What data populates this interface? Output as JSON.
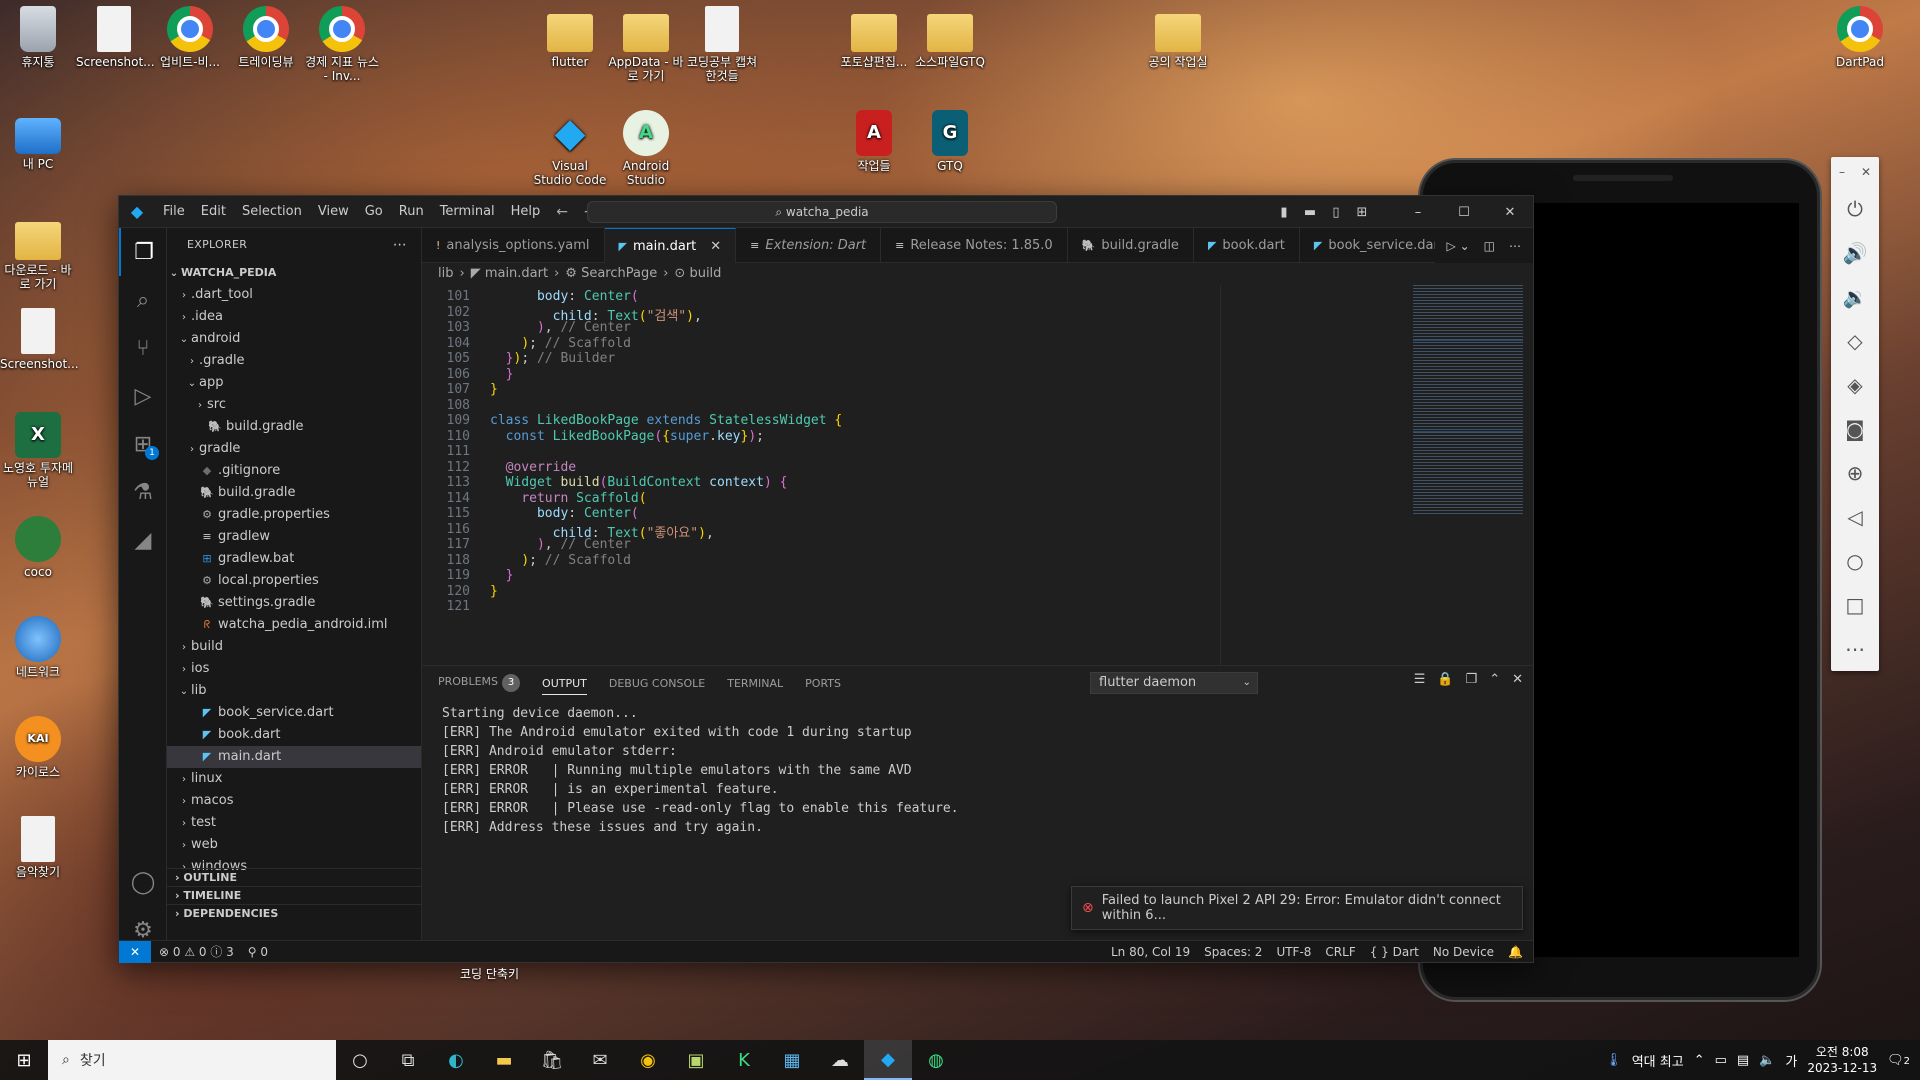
{
  "desktop": {
    "icons": [
      {
        "label": "휴지통",
        "icon": "recycle-bin-icon"
      },
      {
        "label": "Screenshot...",
        "icon": "document-icon"
      },
      {
        "label": "업비트-비...",
        "icon": "chrome-icon"
      },
      {
        "label": "트레이딩뷰",
        "icon": "chrome-icon"
      },
      {
        "label": "경제 지표 뉴스 - Inv...",
        "icon": "chrome-icon"
      },
      {
        "label": "flutter",
        "icon": "folder-icon"
      },
      {
        "label": "AppData - 바로 가기",
        "icon": "folder-icon"
      },
      {
        "label": "코딩공부 캡쳐한것들",
        "icon": "document-icon"
      },
      {
        "label": "포토샵편집...",
        "icon": "folder-icon"
      },
      {
        "label": "소스파일GTQ",
        "icon": "folder-icon"
      },
      {
        "label": "공의 작업실",
        "icon": "folder-icon"
      },
      {
        "label": "DartPad",
        "icon": "chrome-icon"
      },
      {
        "label": "내 PC",
        "icon": "pc-icon"
      },
      {
        "label": "Visual Studio Code",
        "icon": "vscode-icon"
      },
      {
        "label": "Android Studio",
        "icon": "android-studio-icon"
      },
      {
        "label": "작업들",
        "icon": "acrobat-icon"
      },
      {
        "label": "GTQ",
        "icon": "gtq-icon"
      },
      {
        "label": "다운로드 - 바로 가기",
        "icon": "download-folder-icon"
      },
      {
        "label": "Screenshot...",
        "icon": "document-icon"
      },
      {
        "label": "노영호 투자메뉴얼",
        "icon": "excel-icon"
      },
      {
        "label": "coco",
        "icon": "user-folder-icon"
      },
      {
        "label": "네트워크",
        "icon": "network-icon"
      },
      {
        "label": "카이로스",
        "icon": "kairos-icon"
      },
      {
        "label": "음악찾기",
        "icon": "document-icon"
      }
    ],
    "bottom_label": "코딩 단축키"
  },
  "vscode": {
    "menu": [
      "File",
      "Edit",
      "Selection",
      "View",
      "Go",
      "Run",
      "Terminal",
      "Help"
    ],
    "command_center": "watcha_pedia",
    "explorer_title": "EXPLORER",
    "root": "WATCHA_PEDIA",
    "tree": [
      {
        "label": ".dart_tool",
        "depth": 1,
        "kind": "folder",
        "open": false
      },
      {
        "label": ".idea",
        "depth": 1,
        "kind": "folder",
        "open": false
      },
      {
        "label": "android",
        "depth": 1,
        "kind": "folder",
        "open": true
      },
      {
        "label": ".gradle",
        "depth": 2,
        "kind": "folder",
        "open": false
      },
      {
        "label": "app",
        "depth": 2,
        "kind": "folder",
        "open": true
      },
      {
        "label": "src",
        "depth": 3,
        "kind": "folder",
        "open": false
      },
      {
        "label": "build.gradle",
        "depth": 3,
        "kind": "gradle"
      },
      {
        "label": "gradle",
        "depth": 2,
        "kind": "folder",
        "open": false
      },
      {
        "label": ".gitignore",
        "depth": 2,
        "kind": "git"
      },
      {
        "label": "build.gradle",
        "depth": 2,
        "kind": "gradle"
      },
      {
        "label": "gradle.properties",
        "depth": 2,
        "kind": "gear"
      },
      {
        "label": "gradlew",
        "depth": 2,
        "kind": "text"
      },
      {
        "label": "gradlew.bat",
        "depth": 2,
        "kind": "windows"
      },
      {
        "label": "local.properties",
        "depth": 2,
        "kind": "gear"
      },
      {
        "label": "settings.gradle",
        "depth": 2,
        "kind": "gradle"
      },
      {
        "label": "watcha_pedia_android.iml",
        "depth": 2,
        "kind": "rss"
      },
      {
        "label": "build",
        "depth": 1,
        "kind": "folder",
        "open": false
      },
      {
        "label": "ios",
        "depth": 1,
        "kind": "folder",
        "open": false
      },
      {
        "label": "lib",
        "depth": 1,
        "kind": "folder",
        "open": true
      },
      {
        "label": "book_service.dart",
        "depth": 2,
        "kind": "dart"
      },
      {
        "label": "book.dart",
        "depth": 2,
        "kind": "dart"
      },
      {
        "label": "main.dart",
        "depth": 2,
        "kind": "dart",
        "selected": true
      },
      {
        "label": "linux",
        "depth": 1,
        "kind": "folder",
        "open": false
      },
      {
        "label": "macos",
        "depth": 1,
        "kind": "folder",
        "open": false
      },
      {
        "label": "test",
        "depth": 1,
        "kind": "folder",
        "open": false
      },
      {
        "label": "web",
        "depth": 1,
        "kind": "folder",
        "open": false
      },
      {
        "label": "windows",
        "depth": 1,
        "kind": "folder",
        "open": false
      }
    ],
    "sections": [
      "OUTLINE",
      "TIMELINE",
      "DEPENDENCIES"
    ],
    "tabs": [
      {
        "label": "analysis_options.yaml",
        "icon": "!",
        "active": false
      },
      {
        "label": "main.dart",
        "icon": "dart",
        "active": true
      },
      {
        "label": "Extension: Dart",
        "icon": "ext",
        "active": false,
        "italic": true
      },
      {
        "label": "Release Notes: 1.85.0",
        "icon": "notes",
        "active": false
      },
      {
        "label": "build.gradle",
        "icon": "gradle",
        "active": false
      },
      {
        "label": "book.dart",
        "icon": "dart",
        "active": false
      },
      {
        "label": "book_service.dar",
        "icon": "dart",
        "active": false
      }
    ],
    "breadcrumbs": [
      "lib",
      "main.dart",
      "SearchPage",
      "build"
    ],
    "code_lines": [
      {
        "n": "101",
        "html": "      <span class=\"pr\">body</span>: <span class=\"ty\">Center</span><span class=\"br2\">(</span>"
      },
      {
        "n": "102",
        "html": "        <span class=\"pr\">child</span>: <span class=\"ty\">Text</span><span class=\"br\">(</span><span class=\"str\">\"검색\"</span><span class=\"br\">)</span>,"
      },
      {
        "n": "103",
        "html": "      <span class=\"br2\">)</span>, <span class=\"gy\">// Center</span>"
      },
      {
        "n": "104",
        "html": "    <span class=\"br\">)</span>; <span class=\"gy\">// Scaffold</span>"
      },
      {
        "n": "105",
        "html": "  <span class=\"br2\">}</span><span class=\"br\">)</span>; <span class=\"gy\">// Builder</span>"
      },
      {
        "n": "106",
        "html": "  <span class=\"br2\">}</span>"
      },
      {
        "n": "107",
        "html": "<span class=\"br\">}</span>"
      },
      {
        "n": "108",
        "html": ""
      },
      {
        "n": "109",
        "html": "<span class=\"kw\">class</span> <span class=\"ty\">LikedBookPage</span> <span class=\"kw\">extends</span> <span class=\"ty\">StatelessWidget</span> <span class=\"br\">{</span>"
      },
      {
        "n": "110",
        "html": "  <span class=\"kw\">const</span> <span class=\"ty\">LikedBookPage</span><span class=\"br2\">(</span><span class=\"br\">{</span><span class=\"kw\">super</span>.<span class=\"pr\">key</span><span class=\"br\">}</span><span class=\"br2\">)</span>;"
      },
      {
        "n": "111",
        "html": ""
      },
      {
        "n": "112",
        "html": "  <span class=\"an\">@override</span>"
      },
      {
        "n": "113",
        "html": "  <span class=\"ty\">Widget</span> <span class=\"fn\">build</span><span class=\"br2\">(</span><span class=\"ty\">BuildContext</span> <span class=\"pr\">context</span><span class=\"br2\">)</span> <span class=\"br2\">{</span>"
      },
      {
        "n": "114",
        "html": "    <span class=\"an\">return</span> <span class=\"ty\">Scaffold</span><span class=\"br\">(</span>"
      },
      {
        "n": "115",
        "html": "      <span class=\"pr\">body</span>: <span class=\"ty\">Center</span><span class=\"br2\">(</span>"
      },
      {
        "n": "116",
        "html": "        <span class=\"pr\">child</span>: <span class=\"ty\">Text</span><span class=\"br\">(</span><span class=\"str\">\"좋아요\"</span><span class=\"br\">)</span>,"
      },
      {
        "n": "117",
        "html": "      <span class=\"br2\">)</span>, <span class=\"gy\">// Center</span>"
      },
      {
        "n": "118",
        "html": "    <span class=\"br\">)</span>; <span class=\"gy\">// Scaffold</span>"
      },
      {
        "n": "119",
        "html": "  <span class=\"br2\">}</span>"
      },
      {
        "n": "120",
        "html": "<span class=\"br\">}</span>"
      },
      {
        "n": "121",
        "html": ""
      }
    ],
    "panel_tabs": [
      {
        "label": "PROBLEMS",
        "badge": "3"
      },
      {
        "label": "OUTPUT",
        "active": true
      },
      {
        "label": "DEBUG CONSOLE"
      },
      {
        "label": "TERMINAL"
      },
      {
        "label": "PORTS"
      }
    ],
    "output_channel": "flutter daemon",
    "output": [
      "Starting device daemon...",
      "[ERR] The Android emulator exited with code 1 during startup",
      "[ERR] Android emulator stderr:",
      "[ERR] ERROR   | Running multiple emulators with the same AVD",
      "[ERR] ERROR   | is an experimental feature.",
      "[ERR] ERROR   | Please use -read-only flag to enable this feature.",
      "[ERR] Address these issues and try again."
    ],
    "toast": "Failed to launch Pixel 2 API 29: Error: Emulator didn't connect within 6...",
    "status": {
      "problems": "⊗ 0 ⚠ 0 ⓘ 3",
      "ports": "⚲ 0",
      "position": "Ln 80, Col 19",
      "spaces": "Spaces: 2",
      "encoding": "UTF-8",
      "eol": "CRLF",
      "language": "{ } Dart",
      "device": "No Device"
    }
  },
  "taskbar": {
    "search_placeholder": "찾기",
    "tray_text": "역대 최고",
    "time": "오전 8:08",
    "date": "2023-12-13",
    "notifications": "2"
  }
}
